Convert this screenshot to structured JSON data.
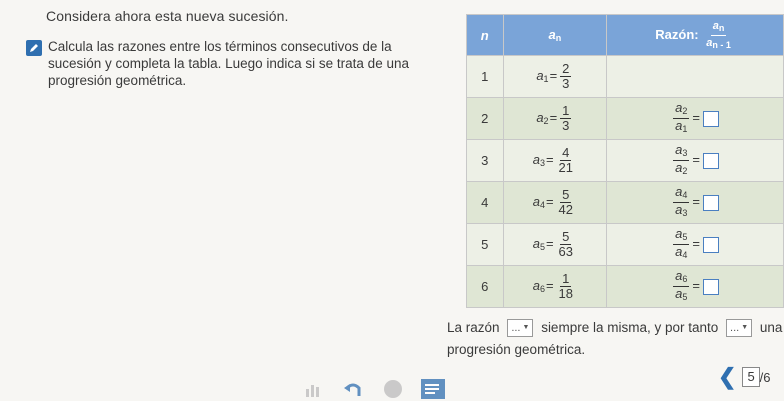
{
  "intro": "Considera ahora esta nueva sucesión.",
  "instruction": "Calcula las razones entre los términos consecutivos de la sucesión y completa la tabla. Luego indica si se trata de una progresión geométrica.",
  "table": {
    "header_n": "n",
    "header_a": "a",
    "header_a_sub": "n",
    "header_ratio_label": "Razón:",
    "header_ratio_num": "a",
    "header_ratio_num_sub": "n",
    "header_ratio_den": "a",
    "header_ratio_den_sub": "n - 1",
    "rows": [
      {
        "n": "1",
        "a_sub": "1",
        "num": "2",
        "den": "3"
      },
      {
        "n": "2",
        "a_sub": "2",
        "num": "1",
        "den": "3",
        "r_num_sub": "2",
        "r_den_sub": "1"
      },
      {
        "n": "3",
        "a_sub": "3",
        "num": "4",
        "den": "21",
        "r_num_sub": "3",
        "r_den_sub": "2"
      },
      {
        "n": "4",
        "a_sub": "4",
        "num": "5",
        "den": "42",
        "r_num_sub": "4",
        "r_den_sub": "3"
      },
      {
        "n": "5",
        "a_sub": "5",
        "num": "5",
        "den": "63",
        "r_num_sub": "5",
        "r_den_sub": "4"
      },
      {
        "n": "6",
        "a_sub": "6",
        "num": "1",
        "den": "18",
        "r_num_sub": "6",
        "r_den_sub": "5"
      }
    ]
  },
  "bottom": {
    "part1": "La razón",
    "dropdown1": "...",
    "part2": "siempre la misma, y por tanto",
    "dropdown2": "...",
    "part3": "una",
    "part4": "progresión geométrica."
  },
  "pager": {
    "current": "5",
    "total": "/6"
  },
  "colors": {
    "header": "#7aa4d8",
    "accent": "#2f6fb0"
  }
}
